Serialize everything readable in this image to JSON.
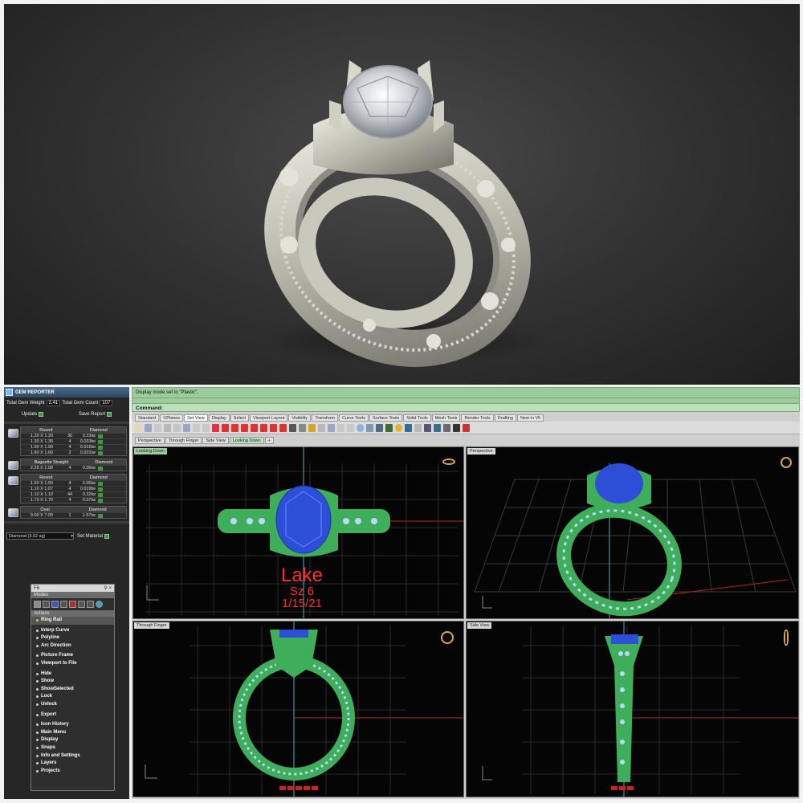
{
  "gem_reporter": {
    "title": "GEM REPORTER",
    "total_weight_label": "Total Gem Weight",
    "total_weight": "2.41",
    "total_count_label": "Total Gem Count",
    "total_count": "107",
    "update_label": "Update",
    "save_report_label": "Save Report",
    "groups": [
      {
        "header": [
          "Round",
          "Diamond"
        ],
        "rows": [
          [
            "1.20 X 1.20",
            "36",
            "0.23tw"
          ],
          [
            "1.30 X 1.30",
            "4",
            "0.033tw"
          ],
          [
            "1.00 X 1.00",
            "4",
            "0.015tw"
          ],
          [
            "1.60 X 1.60",
            "2",
            "0.031tw"
          ]
        ]
      },
      {
        "header": [
          "Baguette Straight",
          "Diamond"
        ],
        "rows": [
          [
            "2.25 X 1.00",
            "4",
            "0.06tw"
          ]
        ]
      },
      {
        "header": [
          "Round",
          "Diamond"
        ],
        "rows": [
          [
            "1.50 X 1.50",
            "4",
            "0.05tw"
          ],
          [
            "1.10 X 1.07",
            "4",
            "0.019tw"
          ],
          [
            "1.10 X 1.10",
            "44",
            "0.22tw"
          ],
          [
            "1.70 X 1.70",
            "4",
            "0.07tw"
          ]
        ]
      },
      {
        "header": [
          "Oval",
          "Diamond"
        ],
        "rows": [
          [
            "9.00 X 7.00",
            "1",
            "1.67tw"
          ]
        ]
      }
    ],
    "material_select": "Diamond    (3.52 sg)",
    "set_material_label": "Set Material"
  },
  "f6_panel": {
    "title": "F6",
    "pin": "⚲ ×",
    "modes_label": "Modes",
    "actions_label": "Actions",
    "items": [
      "Ring Rail",
      "Interp Curve",
      "Polyline",
      "Arc Direction",
      "Picture Frame",
      "Viewport to File",
      "Hide",
      "Show",
      "ShowSelected",
      "Lock",
      "Unlock",
      "Export",
      "Icon History",
      "Main Menu",
      "Display",
      "Snaps",
      "Info and Settings",
      "Layers",
      "Projects"
    ]
  },
  "rhino": {
    "history_text": "Display mode set to \"Plastic\".",
    "command_label": "Command:",
    "tabs": [
      "Standard",
      "CPlanes",
      "Set View",
      "Display",
      "Select",
      "Viewport Layout",
      "Visibility",
      "Transform",
      "Curve Tools",
      "Surface Tools",
      "Solid Tools",
      "Mesh Tools",
      "Render Tools",
      "Drafting",
      "New in V5"
    ],
    "view_tabs": [
      "Perspective",
      "Through Finger",
      "Side View",
      "Looking Down"
    ],
    "viewports": {
      "top_left": "Looking Down",
      "top_right": "Perspective",
      "bottom_left": "Through Finger",
      "bottom_right": "Side View"
    },
    "engraving": {
      "line1": "Lake",
      "line2": "Sz 6",
      "line3": "1/15/21"
    }
  },
  "colors": {
    "metal_green": "#3fae5a",
    "stone_blue": "#2d4fd8",
    "accent_stone": "#bcd6ff",
    "engraving_red": "#ff2a2a",
    "command_green": "#9ccc9c"
  }
}
